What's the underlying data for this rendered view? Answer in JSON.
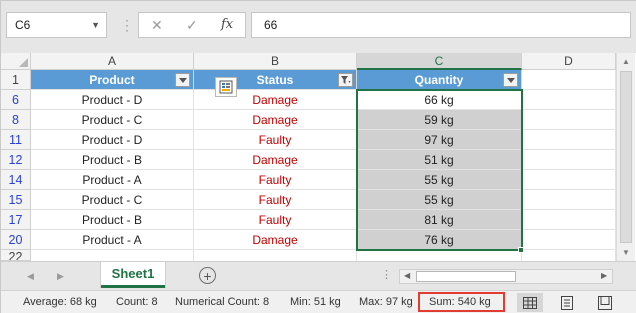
{
  "formula_bar": {
    "name_box": "C6",
    "cancel_glyph": "✕",
    "enter_glyph": "✓",
    "fx_label": "fx",
    "formula_value": "66"
  },
  "columns": [
    "A",
    "B",
    "C",
    "D"
  ],
  "header_row": {
    "row_number": "1",
    "cells": [
      "Product",
      "Status",
      "Quantity"
    ]
  },
  "rows": [
    {
      "row": "6",
      "product": "Product - D",
      "status": "Damage",
      "quantity": "66 kg"
    },
    {
      "row": "8",
      "product": "Product - C",
      "status": "Damage",
      "quantity": "59 kg"
    },
    {
      "row": "11",
      "product": "Product - D",
      "status": "Faulty",
      "quantity": "97 kg"
    },
    {
      "row": "12",
      "product": "Product - B",
      "status": "Damage",
      "quantity": "51 kg"
    },
    {
      "row": "14",
      "product": "Product - A",
      "status": "Faulty",
      "quantity": "55 kg"
    },
    {
      "row": "15",
      "product": "Product - C",
      "status": "Faulty",
      "quantity": "55 kg"
    },
    {
      "row": "17",
      "product": "Product - B",
      "status": "Faulty",
      "quantity": "81 kg"
    },
    {
      "row": "20",
      "product": "Product - A",
      "status": "Damage",
      "quantity": "76 kg"
    }
  ],
  "partial_row": "22",
  "sheet_tab": "Sheet1",
  "add_sheet_glyph": "+",
  "scroll_dots": "⋮",
  "status_bar": {
    "average": "Average: 68 kg",
    "count": "Count: 8",
    "numerical_count": "Numerical Count: 8",
    "min": "Min: 51 kg",
    "max": "Max: 97 kg",
    "sum": "Sum: 540 kg"
  },
  "colors": {
    "accent": "#217346",
    "header_fill": "#5b9bd5",
    "status_text": "#c00000",
    "row_number_filtered": "#2a40d6",
    "sum_highlight": "#e03c31"
  },
  "icons": {
    "status_filter": "funnel-icon",
    "quick_analysis": "quick-analysis-icon",
    "normal_view": "grid-view-icon",
    "page_layout": "page-layout-icon",
    "page_break": "page-break-icon"
  }
}
